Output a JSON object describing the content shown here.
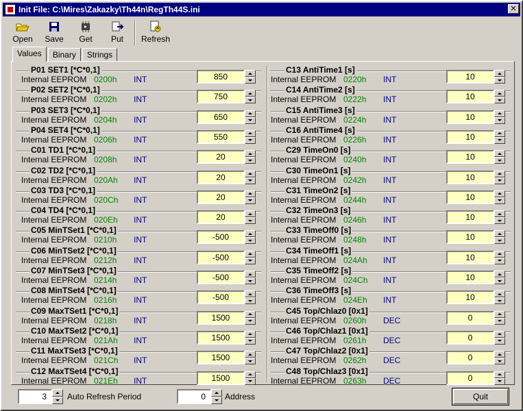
{
  "window": {
    "title": "Init File: C:\\Mires\\Zakazky\\Th44n\\RegTh44S.ini",
    "close_label": "✕"
  },
  "toolbar": [
    {
      "label": "Open",
      "icon": "folder-open-icon"
    },
    {
      "label": "Save",
      "icon": "floppy-disk-icon"
    },
    {
      "label": "Get",
      "icon": "chip-get-icon"
    },
    {
      "label": "Put",
      "icon": "chip-put-icon"
    },
    {
      "label": "Refresh",
      "icon": "refresh-document-icon"
    }
  ],
  "tabs": [
    {
      "label": "Values",
      "active": true
    },
    {
      "label": "Binary",
      "active": false
    },
    {
      "label": "Strings",
      "active": false
    }
  ],
  "params_left": [
    {
      "name": "P01 SET1 [*C*0,1]",
      "mem": "Internal EEPROM",
      "addr": "0200h",
      "type": "INT",
      "value": "850"
    },
    {
      "name": "P02 SET2 [*C*0,1]",
      "mem": "Internal EEPROM",
      "addr": "0202h",
      "type": "INT",
      "value": "750"
    },
    {
      "name": "P03 SET3 [*C*0,1]",
      "mem": "Internal EEPROM",
      "addr": "0204h",
      "type": "INT",
      "value": "650"
    },
    {
      "name": "P04 SET4 [*C*0,1]",
      "mem": "Internal EEPROM",
      "addr": "0206h",
      "type": "INT",
      "value": "550"
    },
    {
      "name": "C01 TD1 [*C*0,1]",
      "mem": "Internal EEPROM",
      "addr": "0208h",
      "type": "INT",
      "value": "20"
    },
    {
      "name": "C02 TD2 [*C*0,1]",
      "mem": "Internal EEPROM",
      "addr": "020Ah",
      "type": "INT",
      "value": "20"
    },
    {
      "name": "C03 TD3 [*C*0,1]",
      "mem": "Internal EEPROM",
      "addr": "020Ch",
      "type": "INT",
      "value": "20"
    },
    {
      "name": "C04 TD4 [*C*0,1]",
      "mem": "Internal EEPROM",
      "addr": "020Eh",
      "type": "INT",
      "value": "20"
    },
    {
      "name": "C05 MinTSet1 [*C*0,1]",
      "mem": "Internal EEPROM",
      "addr": "0210h",
      "type": "INT",
      "value": "-500"
    },
    {
      "name": "C06 MinTSet2 [*C*0,1]",
      "mem": "Internal EEPROM",
      "addr": "0212h",
      "type": "INT",
      "value": "-500"
    },
    {
      "name": "C07 MinTSet3 [*C*0,1]",
      "mem": "Internal EEPROM",
      "addr": "0214h",
      "type": "INT",
      "value": "-500"
    },
    {
      "name": "C08 MinTSet4 [*C*0,1]",
      "mem": "Internal EEPROM",
      "addr": "0216h",
      "type": "INT",
      "value": "-500"
    },
    {
      "name": "C09 MaxTSet1 [*C*0,1]",
      "mem": "Internal EEPROM",
      "addr": "0218h",
      "type": "INT",
      "value": "1500"
    },
    {
      "name": "C10 MaxTSet2 [*C*0,1]",
      "mem": "Internal EEPROM",
      "addr": "021Ah",
      "type": "INT",
      "value": "1500"
    },
    {
      "name": "C11 MaxTSet3 [*C*0,1]",
      "mem": "Internal EEPROM",
      "addr": "021Ch",
      "type": "INT",
      "value": "1500"
    },
    {
      "name": "C12 MaxTSet4 [*C*0,1]",
      "mem": "Internal EEPROM",
      "addr": "021Eh",
      "type": "INT",
      "value": "1500"
    }
  ],
  "params_right": [
    {
      "name": "C13 AntiTime1 [s]",
      "mem": "Internal EEPROM",
      "addr": "0220h",
      "type": "INT",
      "value": "10"
    },
    {
      "name": "C14 AntiTime2 [s]",
      "mem": "Internal EEPROM",
      "addr": "0222h",
      "type": "INT",
      "value": "10"
    },
    {
      "name": "C15 AntiTime3 [s]",
      "mem": "Internal EEPROM",
      "addr": "0224h",
      "type": "INT",
      "value": "10"
    },
    {
      "name": "C16 AntiTime4 [s]",
      "mem": "Internal EEPROM",
      "addr": "0226h",
      "type": "INT",
      "value": "10"
    },
    {
      "name": "C29 TimeOn0 [s]",
      "mem": "Internal EEPROM",
      "addr": "0240h",
      "type": "INT",
      "value": "10"
    },
    {
      "name": "C30 TimeOn1 [s]",
      "mem": "Internal EEPROM",
      "addr": "0242h",
      "type": "INT",
      "value": "10"
    },
    {
      "name": "C31 TimeOn2 [s]",
      "mem": "Internal EEPROM",
      "addr": "0244h",
      "type": "INT",
      "value": "10"
    },
    {
      "name": "C32 TimeOn3 [s]",
      "mem": "Internal EEPROM",
      "addr": "0246h",
      "type": "INT",
      "value": "10"
    },
    {
      "name": "C33 TimeOff0 [s]",
      "mem": "Internal EEPROM",
      "addr": "0248h",
      "type": "INT",
      "value": "10"
    },
    {
      "name": "C34 TimeOff1 [s]",
      "mem": "Internal EEPROM",
      "addr": "024Ah",
      "type": "INT",
      "value": "10"
    },
    {
      "name": "C35 TimeOff2 [s]",
      "mem": "Internal EEPROM",
      "addr": "024Ch",
      "type": "INT",
      "value": "10"
    },
    {
      "name": "C36 TimeOff3 [s]",
      "mem": "Internal EEPROM",
      "addr": "024Eh",
      "type": "INT",
      "value": "10"
    },
    {
      "name": "C45 Top/Chlaz0 [0x1]",
      "mem": "Internal EEPROM",
      "addr": "0260h",
      "type": "DEC",
      "value": "0"
    },
    {
      "name": "C46 Top/Chlaz1 [0x1]",
      "mem": "Internal EEPROM",
      "addr": "0261h",
      "type": "DEC",
      "value": "0"
    },
    {
      "name": "C47 Top/Chlaz2 [0x1]",
      "mem": "Internal EEPROM",
      "addr": "0262h",
      "type": "DEC",
      "value": "0"
    },
    {
      "name": "C48 Top/Chlaz3 [0x1]",
      "mem": "Internal EEPROM",
      "addr": "0263h",
      "type": "DEC",
      "value": "0"
    }
  ],
  "footer": {
    "refresh_period_value": "3",
    "refresh_period_label": "Auto Refresh Period",
    "address_value": "0",
    "address_label": "Address",
    "quit_label": "Quit"
  },
  "colors": {
    "title_bg": "#000080",
    "addr": "#008000",
    "type": "#000080",
    "value_bg": "#ffffc0",
    "face": "#d4d0c8"
  }
}
